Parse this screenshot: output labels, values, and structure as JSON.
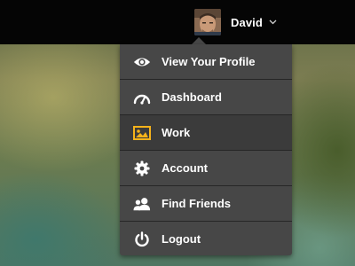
{
  "user": {
    "name": "David"
  },
  "menu": {
    "items": [
      {
        "label": "View Your Profile",
        "icon": "eye-icon"
      },
      {
        "label": "Dashboard",
        "icon": "gauge-icon"
      },
      {
        "label": "Work",
        "icon": "image-icon",
        "active": true
      },
      {
        "label": "Account",
        "icon": "gear-icon"
      },
      {
        "label": "Find Friends",
        "icon": "people-icon"
      },
      {
        "label": "Logout",
        "icon": "power-icon"
      }
    ]
  },
  "colors": {
    "topbar": "#050505",
    "menu_bg": "#474747",
    "menu_active_bg": "#3b3b3b",
    "divider": "#262626",
    "work_icon_accent": "#f5b21a"
  }
}
